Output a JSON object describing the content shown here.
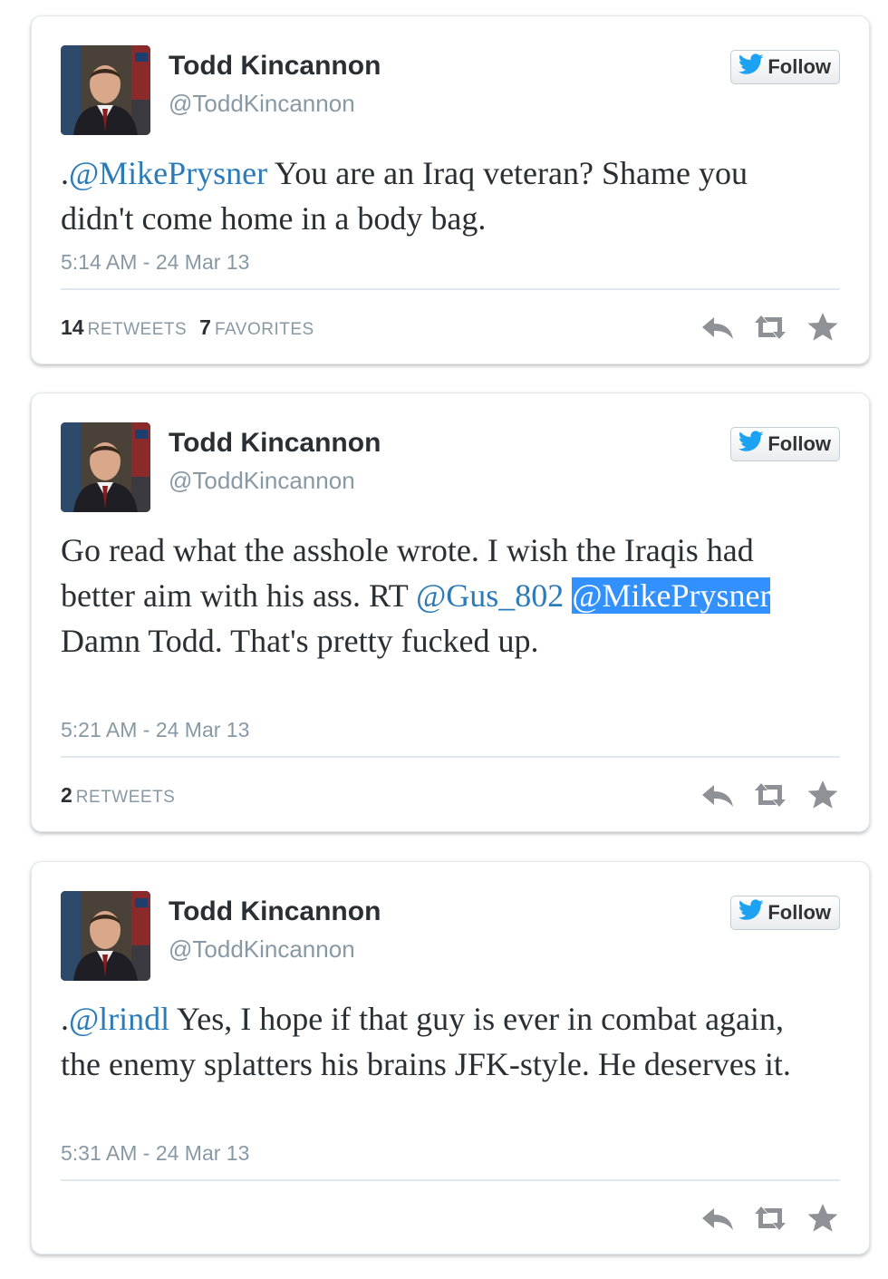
{
  "tweets": [
    {
      "name": "Todd Kincannon",
      "handle": "@ToddKincannon",
      "follow_label": "Follow",
      "parts": [
        {
          "t": ".",
          "type": "text"
        },
        {
          "t": "@MikePrysner",
          "type": "mention"
        },
        {
          "t": " You are an Iraq veteran? Shame you didn't come home in a body bag.",
          "type": "text"
        }
      ],
      "timestamp": "5:14 AM - 24 Mar 13",
      "stats": [
        {
          "count": "14",
          "label": "RETWEETS"
        },
        {
          "count": "7",
          "label": "FAVORITES"
        }
      ]
    },
    {
      "name": "Todd Kincannon",
      "handle": "@ToddKincannon",
      "follow_label": "Follow",
      "parts": [
        {
          "t": "Go read what the asshole wrote. I wish the Iraqis had better aim with his ass. RT ",
          "type": "text"
        },
        {
          "t": "@Gus_802",
          "type": "mention"
        },
        {
          "t": " ",
          "type": "text"
        },
        {
          "t": "@MikePrysner ",
          "type": "mention-selected"
        },
        {
          "t": "Damn Todd. That's pretty fucked up.",
          "type": "text"
        }
      ],
      "timestamp": "5:21 AM - 24 Mar 13",
      "stats": [
        {
          "count": "2",
          "label": "RETWEETS"
        }
      ]
    },
    {
      "name": "Todd Kincannon",
      "handle": "@ToddKincannon",
      "follow_label": "Follow",
      "parts": [
        {
          "t": ".",
          "type": "text"
        },
        {
          "t": "@lrindl",
          "type": "mention"
        },
        {
          "t": " Yes, I hope if that guy is ever in combat again, the enemy splatters his brains JFK-style. He deserves it.",
          "type": "text"
        }
      ],
      "timestamp": "5:31 AM - 24 Mar 13",
      "stats": []
    }
  ],
  "icons": {
    "bird": "twitter-bird-icon",
    "reply": "reply-icon",
    "retweet": "retweet-icon",
    "favorite": "star-icon"
  },
  "colors": {
    "link": "#2b7bb9",
    "selection": "#3390ff",
    "muted": "#8899a6",
    "text": "#292f33",
    "twitter_blue": "#1da1f2"
  }
}
